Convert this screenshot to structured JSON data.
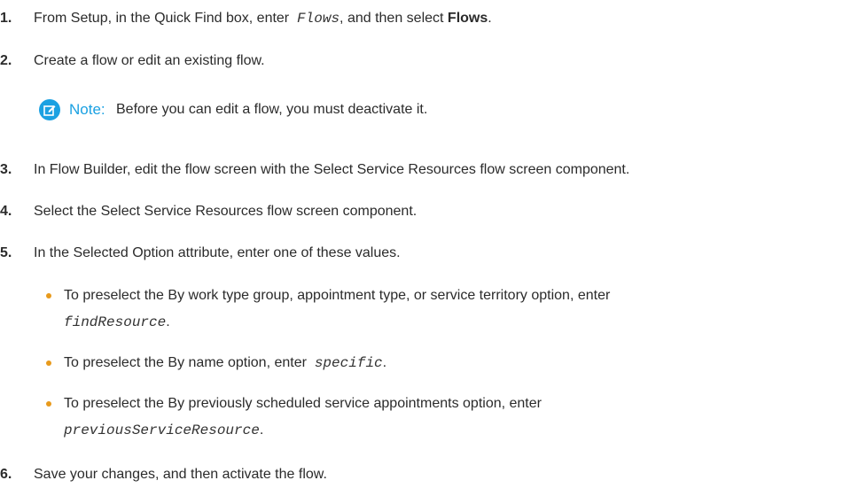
{
  "colors": {
    "note_accent": "#1ba1e2",
    "bullet": "#e89a1c",
    "text": "#2b2b2b"
  },
  "steps": [
    {
      "number": "1.",
      "pre": "From Setup, in the Quick Find box, enter",
      "code": "Flows",
      "mid": ", and then select",
      "bold": "Flows",
      "post": "."
    },
    {
      "number": "2.",
      "text": "Create a flow or edit an existing flow."
    },
    {
      "number": "3.",
      "text": "In Flow Builder, edit the flow screen with the Select Service Resources flow screen component."
    },
    {
      "number": "4.",
      "text": "Select the Select Service Resources flow screen component."
    },
    {
      "number": "5.",
      "text": "In the Selected Option attribute, enter one of these values."
    },
    {
      "number": "6.",
      "text": "Save your changes, and then activate the flow."
    }
  ],
  "note": {
    "icon": "edit-note-icon",
    "label": "Note:",
    "text": "Before you can edit a flow, you must deactivate it."
  },
  "bullets": [
    {
      "line1": "To preselect the By work type group, appointment type, or service territory option, enter",
      "code": "findResource",
      "post": "."
    },
    {
      "pre": "To preselect the By name option, enter",
      "code": "specific",
      "post": "."
    },
    {
      "line1": "To preselect the By previously scheduled service appointments option, enter",
      "code": "previousServiceResource",
      "post": "."
    }
  ]
}
